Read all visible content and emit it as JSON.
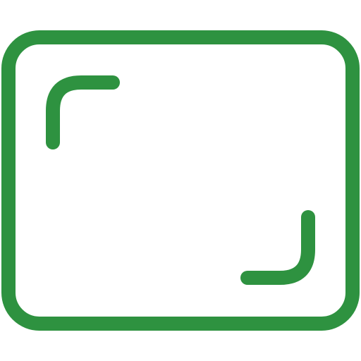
{
  "icon": {
    "name": "aspect-ratio-icon",
    "stroke_color": "#2e9240",
    "background_color": "#ffffff"
  }
}
